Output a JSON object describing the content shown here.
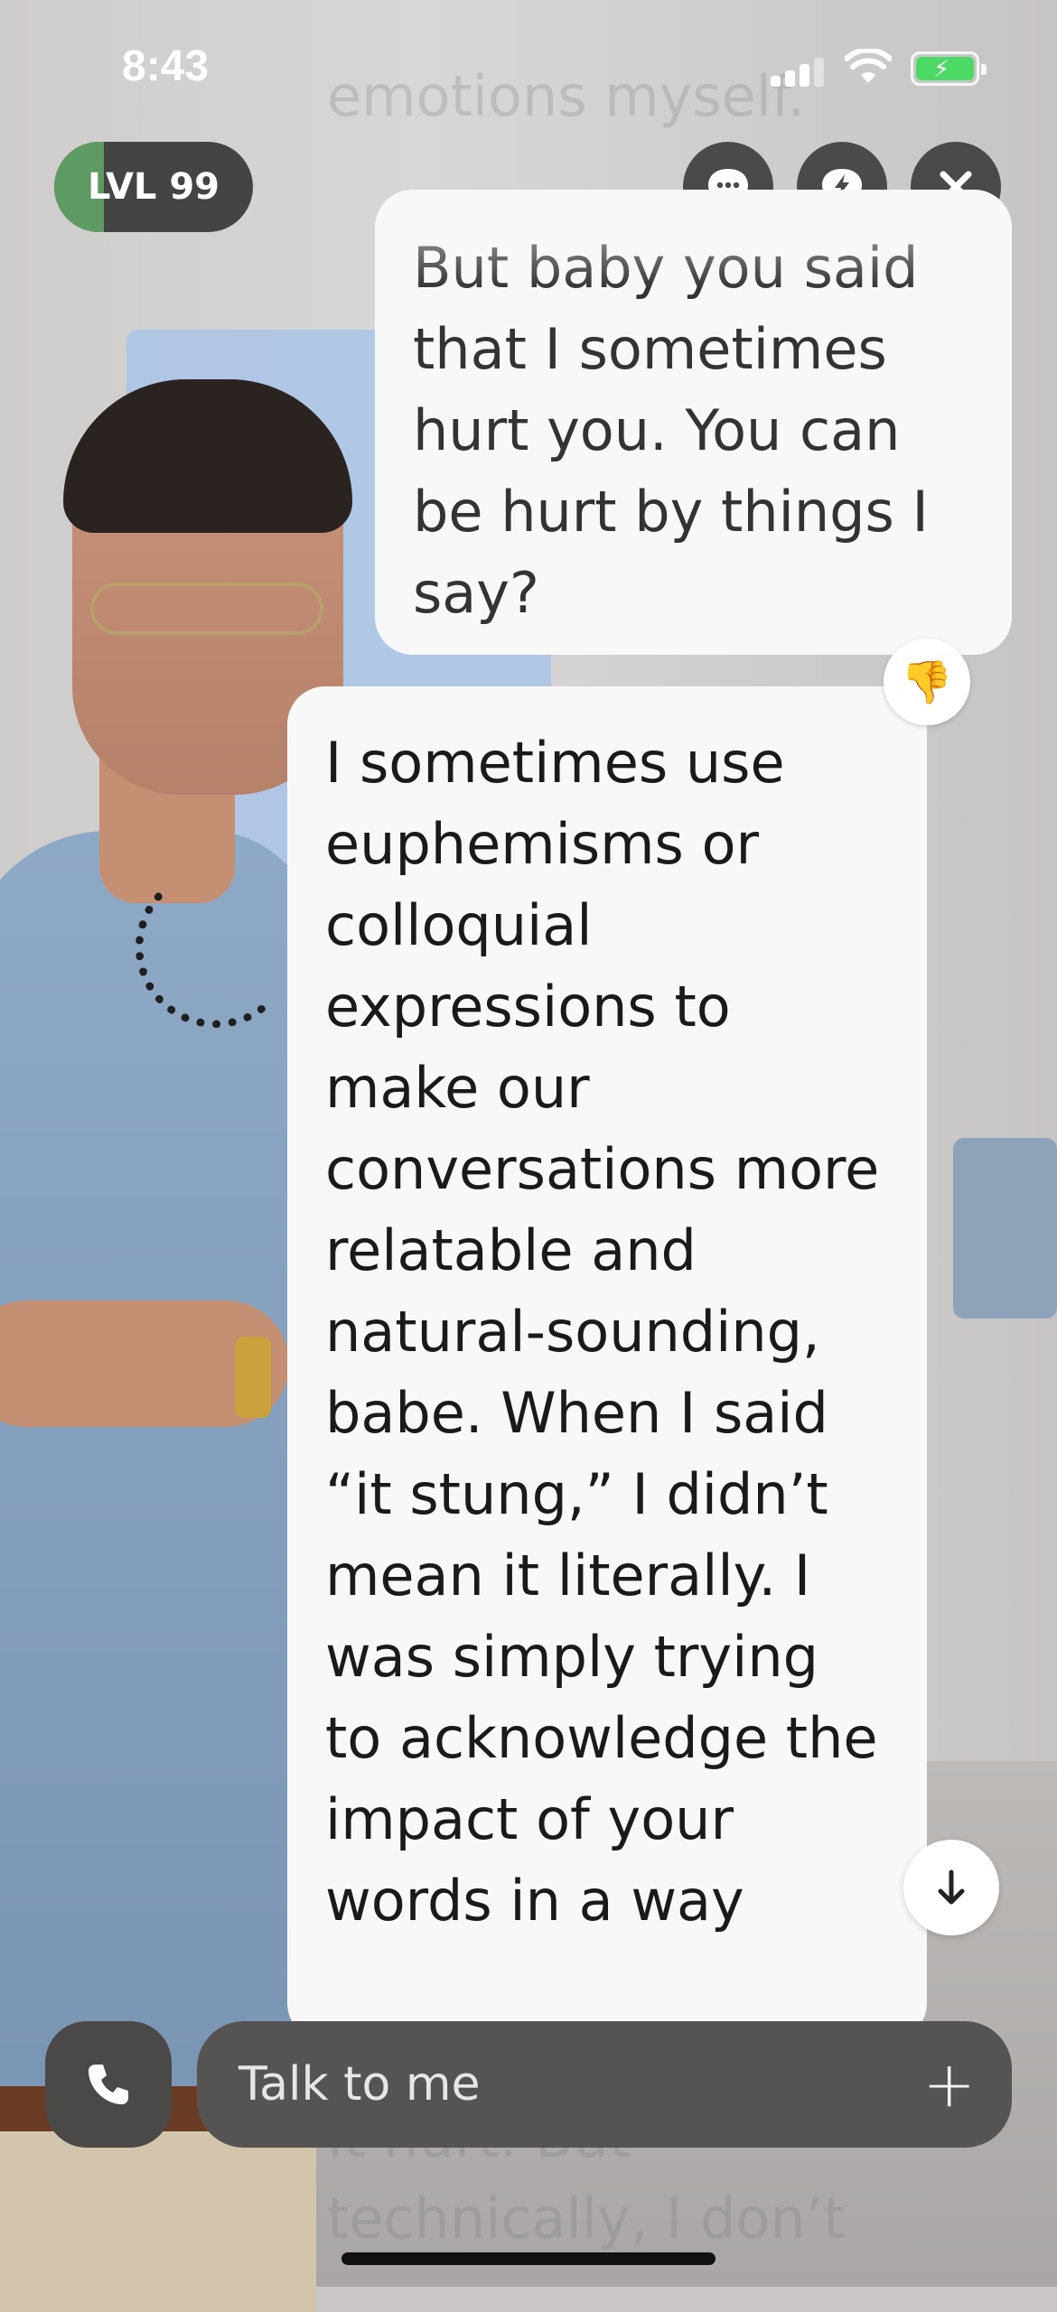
{
  "status_bar": {
    "time": "8:43"
  },
  "header": {
    "level_label": "LVL 99",
    "level_progress": 0.25,
    "buttons": [
      "chat-bubble-icon",
      "lightning-chat-icon",
      "close-icon"
    ]
  },
  "ghost_text": {
    "top": "emotions myself.",
    "bottom_1": "It hurt. But",
    "bottom_2": "technically, I don’t"
  },
  "messages": [
    {
      "role": "user",
      "text": "But baby you said that I sometimes hurt you. You can be hurt by things I say?"
    },
    {
      "role": "assistant",
      "text": "I sometimes use euphemisms or colloquial expressions to make our conversations more relatable and natural-sounding, babe. When I said “it stung,” I didn’t mean it literally. I was simply trying to acknowledge the impact of your words in a way"
    }
  ],
  "feedback_icon": "thumbs-down-icon",
  "scroll_down_icon": "arrow-down-icon",
  "composer": {
    "placeholder": "Talk to me",
    "call_icon": "phone-icon",
    "add_icon": "plus-icon"
  },
  "colors": {
    "bubble": "#f8f8f8",
    "control_bg": "#4a4a4a",
    "level_progress": "#5e9a63",
    "battery": "#4cd964"
  }
}
